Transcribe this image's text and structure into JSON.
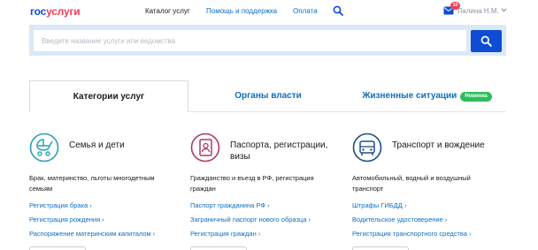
{
  "header": {
    "logo_part1": "гос",
    "logo_part2": "услуги",
    "nav": [
      "Каталог услуг",
      "Помощь и поддержка",
      "Оплата"
    ],
    "mail_badge": "10",
    "username": "Лалина Н.М."
  },
  "search": {
    "placeholder": "Введите название услуги или ведомства"
  },
  "tabs": [
    {
      "label": "Категории услуг"
    },
    {
      "label": "Органы власти"
    },
    {
      "label": "Жизненные ситуации",
      "badge": "Новинка"
    }
  ],
  "categories": [
    {
      "icon": "baby-carriage-icon",
      "title": "Семья и дети",
      "description": "Брак, материнство, льготы многодетным семьям",
      "links": [
        "Регистрация брака",
        "Регистрация рождения",
        "Распоряжение материнским капиталом"
      ]
    },
    {
      "icon": "passport-icon",
      "title": "Паспорта, регистрации, визы",
      "description": "Гражданство и въезд в РФ, регистрация граждан",
      "links": [
        "Паспорт гражданина РФ",
        "Заграничный паспорт нового образца",
        "Регистрация граждан"
      ]
    },
    {
      "icon": "car-icon",
      "title": "Транспорт и вождение",
      "description": "Автомобильный, водный и воздушный транспорт",
      "links": [
        "Штрафы ГИБДД",
        "Водительское удостоверение",
        "Регистрация транспортного средства"
      ]
    }
  ],
  "colors": {
    "brand_blue": "#0d4cd3",
    "brand_red": "#ee3f58",
    "link_blue": "#0d6fc2",
    "search_band": "#dbe8f7",
    "new_badge_green": "#2fbd5b",
    "family_icon": "#2aa3b4",
    "passport_icon": "#b33a5e",
    "transport_icon": "#1f4f8a"
  }
}
